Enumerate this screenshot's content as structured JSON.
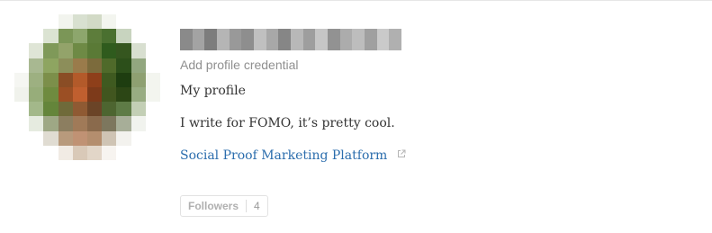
{
  "profile": {
    "credential_prompt": "Add profile credential",
    "my_profile_label": "My profile",
    "bio": "I write for FOMO, it’s pretty cool.",
    "website_link": "Social Proof Marketing Platform",
    "followers_label": "Followers",
    "followers_count": "4"
  },
  "avatar": {
    "pixels": [
      "#ffffff",
      "#ffffff",
      "#ffffff",
      "#f2f4ee",
      "#d8e0d0",
      "#d2dac6",
      "#f3f5ef",
      "#ffffff",
      "#ffffff",
      "#ffffff",
      "#ffffff",
      "#ffffff",
      "#dbe3d2",
      "#7b9657",
      "#8da66d",
      "#5d7d3b",
      "#4a7030",
      "#c8d4bf",
      "#ffffff",
      "#ffffff",
      "#ffffff",
      "#dfe5d6",
      "#7f9959",
      "#93a36a",
      "#6e8a45",
      "#5a7a36",
      "#2f5b1d",
      "#35561f",
      "#d8dfd0",
      "#ffffff",
      "#ffffff",
      "#a8b891",
      "#8ea561",
      "#8c8e5a",
      "#9a7b4b",
      "#7c6b3c",
      "#4f6a2a",
      "#2c4f1a",
      "#92a77f",
      "#ffffff",
      "#f5f6f2",
      "#9db081",
      "#7c8f4a",
      "#8a4d25",
      "#b35a2a",
      "#8e3f1a",
      "#3f5a20",
      "#1e3d10",
      "#8ea071",
      "#f3f5ef",
      "#f0f2ec",
      "#97ad7a",
      "#6f8b3f",
      "#9b4f24",
      "#c05f2f",
      "#7d3a1a",
      "#41561f",
      "#2c4615",
      "#98ac82",
      "#f3f5ef",
      "#ffffff",
      "#a3b88a",
      "#64853a",
      "#6f6a3a",
      "#8f5a33",
      "#6b4427",
      "#4d6530",
      "#5e7b46",
      "#c3cfb5",
      "#ffffff",
      "#ffffff",
      "#e6ebe0",
      "#9ea885",
      "#8c7e60",
      "#a07a58",
      "#8a6a4c",
      "#7d775e",
      "#a7ae98",
      "#f1f3ee",
      "#ffffff",
      "#ffffff",
      "#ffffff",
      "#e0dcd2",
      "#b89a7c",
      "#c09274",
      "#b48e6e",
      "#cfc4b4",
      "#f3f2ee",
      "#ffffff",
      "#ffffff",
      "#ffffff",
      "#ffffff",
      "#ffffff",
      "#f1ebe4",
      "#d9c9b8",
      "#e2d6c8",
      "#f7f4f0",
      "#ffffff",
      "#ffffff",
      "#ffffff"
    ]
  },
  "name_blur": {
    "pixels": [
      "#8a8a8a",
      "#a3a3a3",
      "#7d7d7d",
      "#b5b5b5",
      "#999999",
      "#8e8e8e",
      "#c0c0c0",
      "#a8a8a8",
      "#868686",
      "#b8b8b8",
      "#9e9e9e",
      "#c6c6c6",
      "#929292",
      "#acacac",
      "#bdbdbd",
      "#a0a0a0",
      "#cacaca",
      "#b0b0b0"
    ]
  },
  "colors": {
    "link": "#2b6dad",
    "credential": "#8f8f8f",
    "body_text": "#333333"
  },
  "icons": {
    "external_link": "external-link-icon"
  }
}
